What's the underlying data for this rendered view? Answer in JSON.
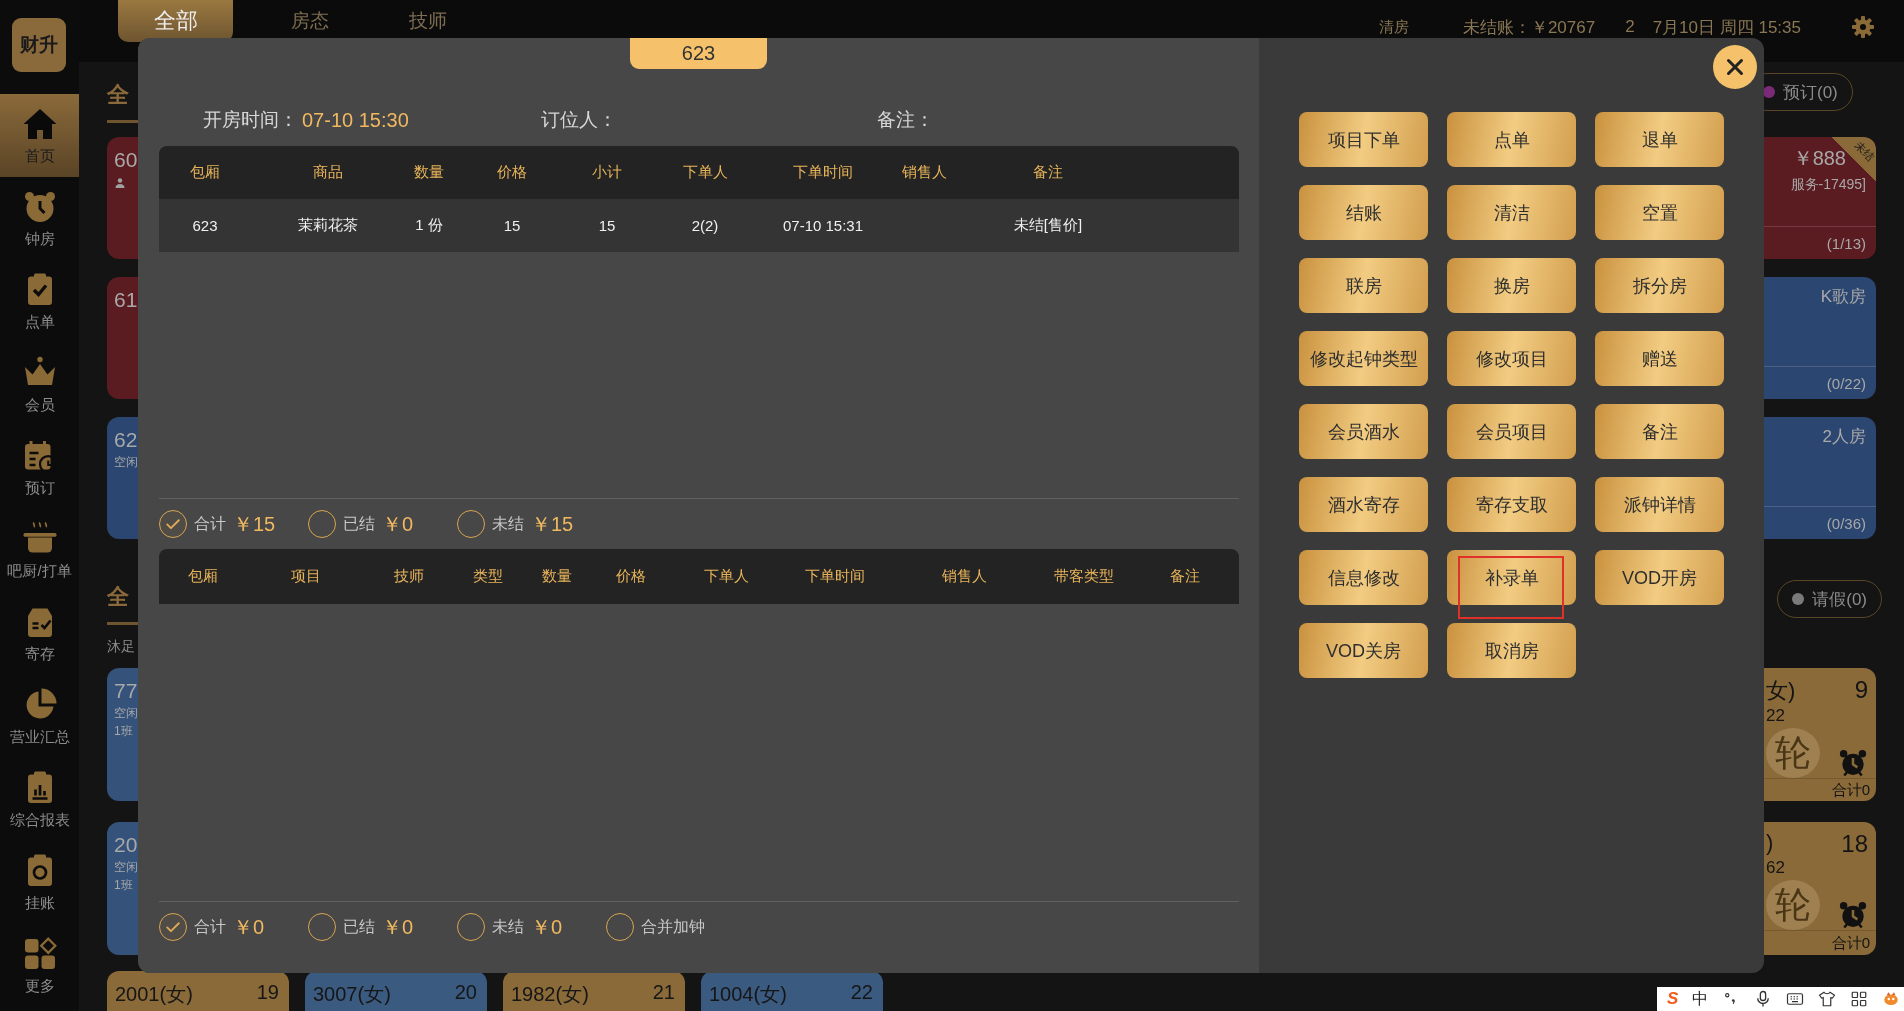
{
  "sidebar": {
    "logo": "财升",
    "items": [
      {
        "label": "首页",
        "selected": true
      },
      {
        "label": "钟房",
        "selected": false
      },
      {
        "label": "点单",
        "selected": false
      },
      {
        "label": "会员",
        "selected": false
      },
      {
        "label": "预订",
        "selected": false
      },
      {
        "label": "吧厨/打单",
        "selected": false
      },
      {
        "label": "寄存",
        "selected": false
      },
      {
        "label": "营业汇总",
        "selected": false
      },
      {
        "label": "综合报表",
        "selected": false
      },
      {
        "label": "挂账",
        "selected": false
      },
      {
        "label": "更多",
        "selected": false
      }
    ]
  },
  "top_bar": {
    "tabs": [
      {
        "label": "全部",
        "selected": true
      },
      {
        "label": "房态",
        "selected": false
      },
      {
        "label": "技师",
        "selected": false
      }
    ],
    "status": [
      "清房",
      "未结账：￥20767",
      "2",
      "7月10日 周四 15:35"
    ]
  },
  "background": {
    "left_column": {
      "heading_1": "全",
      "room_cards": [
        {
          "number": "60",
          "guest_icon": true,
          "color": "#5a1b21"
        },
        {
          "number": "61",
          "color": "#5a1b21"
        },
        {
          "number": "62",
          "status": "空闲",
          "color": "#2b4670"
        }
      ],
      "heading_2": "全",
      "category": "沐足",
      "tech_cards": [
        {
          "number": "77",
          "status": "空闲",
          "shift": "1班",
          "color": "#34527a"
        },
        {
          "number": "20",
          "status": "空闲",
          "shift": "1班",
          "color": "#34527a"
        }
      ],
      "bottom_cards": [
        {
          "name": "2001(女)",
          "number": "19",
          "color": "#8a6a38"
        },
        {
          "name": "3007(女)",
          "number": "20",
          "color": "#3a5a80"
        },
        {
          "name": "1982(女)",
          "number": "21",
          "color": "#8a6a38"
        },
        {
          "name": "1004(女)",
          "number": "22",
          "color": "#3a5a80"
        }
      ]
    },
    "right_column": {
      "pill_1": {
        "label": "预订(0)",
        "color": "#7b2a78"
      },
      "room_cards": [
        {
          "price": "￥888",
          "ribbon": "未结",
          "note": "服务-17495]",
          "count": "(1/13)",
          "color": "#5a1b21"
        },
        {
          "type": "K歌房",
          "count": "(0/22)",
          "color": "#2b4670"
        },
        {
          "type": "2人房",
          "count": "(0/36)",
          "color": "#2b4670"
        }
      ],
      "pill_2": {
        "label": "请假(0)",
        "color": "#7a7a7a"
      },
      "tech_cards": [
        {
          "name": "女)",
          "number": "9",
          "code": "22",
          "badge": "轮",
          "alarm": true,
          "total": "合计0",
          "color": "#8a6a38"
        },
        {
          "name": ")",
          "number": "18",
          "code": "62",
          "badge": "轮",
          "alarm": true,
          "total": "合计0",
          "color": "#8a6a38"
        }
      ]
    }
  },
  "dialog": {
    "room": "623",
    "info": [
      {
        "label": "开房时间：",
        "value": "07-10 15:30"
      },
      {
        "label": "订位人："
      },
      {
        "label": "备注："
      }
    ],
    "orders": {
      "columns": [
        "包厢",
        "商品",
        "数量",
        "价格",
        "小计",
        "下单人",
        "下单时间",
        "销售人",
        "备注"
      ],
      "rows": [
        {
          "room": "623",
          "item": "茉莉花茶",
          "quantity": "1 份",
          "price": "15",
          "subtotal": "15",
          "ordered_by": "2(2)",
          "order_time": "07-10 15:31",
          "note": "未结[售价]"
        }
      ]
    },
    "orders_summary": [
      {
        "label": "合计",
        "amount": "￥15",
        "checked": true
      },
      {
        "label": "已结",
        "amount": "￥0",
        "checked": false
      },
      {
        "label": "未结",
        "amount": "￥15",
        "checked": false
      }
    ],
    "services": {
      "columns": [
        "包厢",
        "项目",
        "技师",
        "类型",
        "数量",
        "价格",
        "下单人",
        "下单时间",
        "销售人",
        "带客类型",
        "备注"
      ]
    },
    "services_summary": [
      {
        "label": "合计",
        "amount": "￥0",
        "checked": true
      },
      {
        "label": "已结",
        "amount": "￥0",
        "checked": false
      },
      {
        "label": "未结",
        "amount": "￥0",
        "checked": false
      },
      {
        "label": "合并加钟",
        "checked": false
      }
    ],
    "actions": [
      {
        "label": "项目下单",
        "highlighted": false
      },
      {
        "label": "点单",
        "highlighted": false
      },
      {
        "label": "退单",
        "highlighted": false
      },
      {
        "label": "结账",
        "highlighted": false
      },
      {
        "label": "清洁",
        "highlighted": false
      },
      {
        "label": "空置",
        "highlighted": false
      },
      {
        "label": "联房",
        "highlighted": false
      },
      {
        "label": "换房",
        "highlighted": false
      },
      {
        "label": "拆分房",
        "highlighted": false
      },
      {
        "label": "修改起钟类型",
        "highlighted": false
      },
      {
        "label": "修改项目",
        "highlighted": false
      },
      {
        "label": "赠送",
        "highlighted": false
      },
      {
        "label": "会员酒水",
        "highlighted": false
      },
      {
        "label": "会员项目",
        "highlighted": false
      },
      {
        "label": "备注",
        "highlighted": false
      },
      {
        "label": "酒水寄存",
        "highlighted": false
      },
      {
        "label": "寄存支取",
        "highlighted": false
      },
      {
        "label": "派钟详情",
        "highlighted": false
      },
      {
        "label": "信息修改",
        "highlighted": false
      },
      {
        "label": "补录单",
        "highlighted": true
      },
      {
        "label": "VOD开房",
        "highlighted": false
      },
      {
        "label": "VOD关房",
        "highlighted": false
      },
      {
        "label": "取消房",
        "highlighted": false
      }
    ]
  },
  "ime_bar": {
    "logo": "S",
    "mode": "中"
  }
}
